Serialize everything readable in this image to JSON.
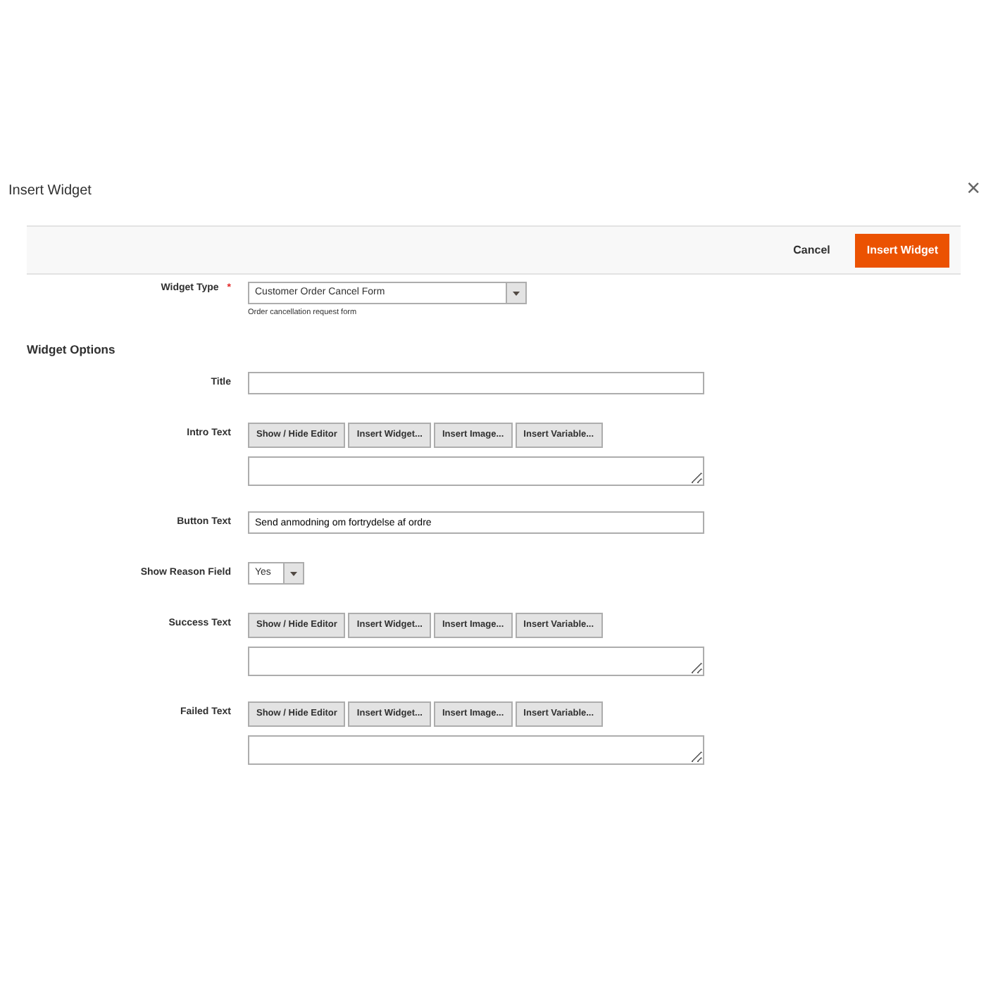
{
  "modal": {
    "title": "Insert Widget",
    "close": "×"
  },
  "actions": {
    "cancel": "Cancel",
    "submit": "Insert Widget"
  },
  "widget_type": {
    "label": "Widget Type",
    "required_mark": "*",
    "value": "Customer Order Cancel Form",
    "note": "Order cancellation request form"
  },
  "section_title": "Widget Options",
  "fields": [
    {
      "kind": "text",
      "label": "Title"
    },
    {
      "kind": "editor",
      "label": "Intro Text",
      "buttons": [
        "Show / Hide Editor",
        "Insert Widget...",
        "Insert Image...",
        "Insert Variable..."
      ]
    },
    {
      "kind": "text",
      "label": "Button Text",
      "value": "Send anmodning om fortrydelse af ordre"
    },
    {
      "kind": "select",
      "label": "Show Reason Field",
      "value": "Yes"
    },
    {
      "kind": "editor",
      "label": "Success Text",
      "buttons": [
        "Show / Hide Editor",
        "Insert Widget...",
        "Insert Image...",
        "Insert Variable..."
      ]
    },
    {
      "kind": "editor",
      "label": "Failed Text",
      "buttons": [
        "Show / Hide Editor",
        "Insert Widget...",
        "Insert Image...",
        "Insert Variable..."
      ]
    }
  ]
}
